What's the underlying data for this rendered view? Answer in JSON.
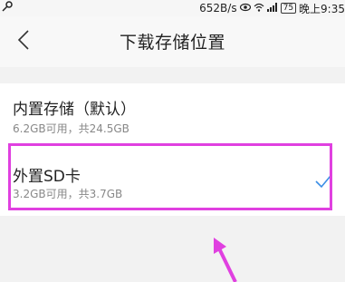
{
  "status_bar": {
    "left_icon": "key-icon",
    "network_speed": "652B/s",
    "icons": [
      "eye-icon",
      "wifi-icon",
      "signal-icon"
    ],
    "battery": "75",
    "time": "晚上9:35"
  },
  "header": {
    "back_icon": "chevron-left-icon",
    "title": "下载存储位置"
  },
  "options": [
    {
      "title": "内置存储（默认）",
      "subtitle": "6.2GB可用，共24.5GB",
      "selected": false
    },
    {
      "title": "外置SD卡",
      "subtitle": "3.2GB可用，共3.7GB",
      "selected": true
    }
  ],
  "colors": {
    "accent": "#3a8ee6",
    "annotation": "#e040e0"
  }
}
